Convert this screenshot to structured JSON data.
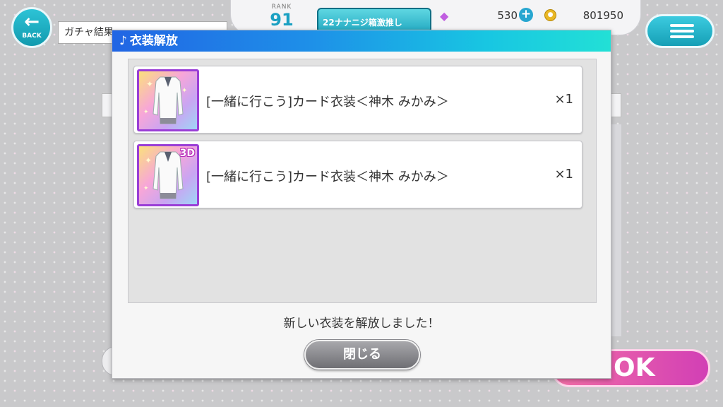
{
  "back_button": {
    "label": "BACK"
  },
  "page_tab": {
    "title": "ガチャ結果"
  },
  "status": {
    "rank_label": "RANK",
    "rank_value": "91",
    "banner_text": "22ナナニジ箱激推し",
    "gems": "530",
    "coins": "801950"
  },
  "ok_button": {
    "label": "OK"
  },
  "modal": {
    "title": "衣装解放",
    "title_icon": "♪",
    "items": [
      {
        "name": "[一緒に行こう]カード衣装＜神木 みかみ＞",
        "quantity": "×1",
        "badge": ""
      },
      {
        "name": "[一緒に行こう]カード衣装＜神木 みかみ＞",
        "quantity": "×1",
        "badge": "3D"
      }
    ],
    "message": "新しい衣装を解放しました！",
    "close_label": "閉じる"
  },
  "colors": {
    "header_start": "#2165e4",
    "header_end": "#22e0d6",
    "thumb_border": "#9a3ed6",
    "ok_button": "#e055ad"
  },
  "icons": {
    "back": "arrow-left-icon",
    "gem": "gem-icon",
    "coin": "coin-icon",
    "add": "plus-icon",
    "menu": "hamburger-menu-icon",
    "title": "music-note-icon"
  }
}
